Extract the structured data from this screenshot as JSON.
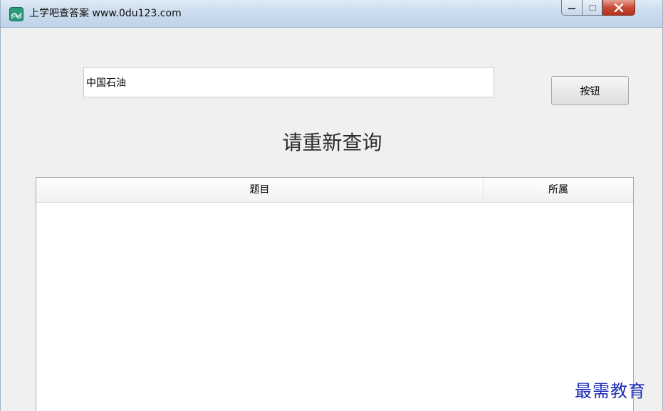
{
  "window": {
    "title": "上学吧查答案 www.0du123.com",
    "app_icon": "app-logo-icon",
    "controls": {
      "minimize": "minimize-icon",
      "maximize": "maximize-icon",
      "close": "close-icon"
    }
  },
  "search": {
    "value": "中国石油",
    "placeholder": ""
  },
  "actions": {
    "button_label": "按钮"
  },
  "status": {
    "message": "请重新查询"
  },
  "results_table": {
    "columns": [
      "题目",
      "所属"
    ],
    "rows": []
  },
  "watermark": {
    "text": "最需教育"
  },
  "colors": {
    "close_button": "#c74b36",
    "titlebar": "#cbdcee",
    "window_bg": "#f0f0f0",
    "watermark": "#1d2bb8"
  }
}
